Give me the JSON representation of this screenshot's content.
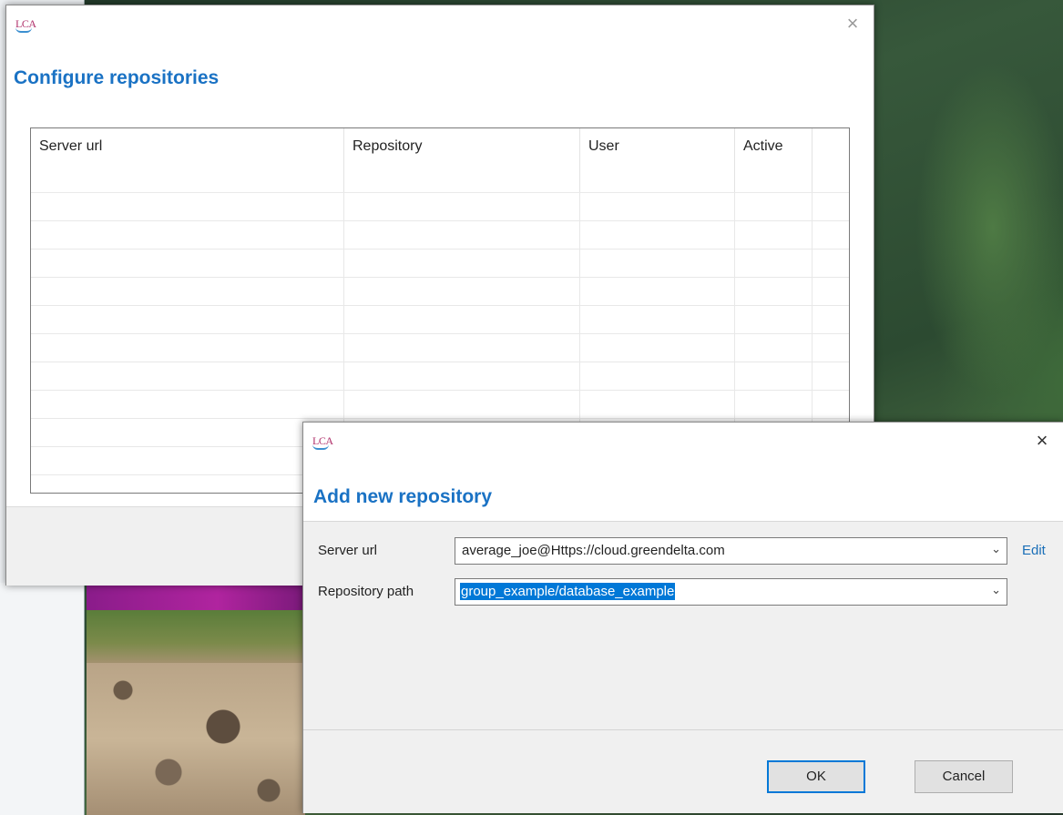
{
  "configure_dialog": {
    "app_icon_text": "LCA",
    "close_glyph": "×",
    "title": "Configure repositories",
    "table": {
      "columns": [
        "Server url",
        "Repository",
        "User",
        "Active"
      ],
      "rows": []
    }
  },
  "add_dialog": {
    "app_icon_text": "LCA",
    "close_glyph": "×",
    "title": "Add new repository",
    "server_url": {
      "label": "Server url",
      "value": "average_joe@Https://cloud.greendelta.com",
      "edit_label": "Edit"
    },
    "repository_path": {
      "label": "Repository path",
      "value": "group_example/database_example"
    },
    "ok_label": "OK",
    "cancel_label": "Cancel"
  },
  "icons": {
    "dropdown": "chevron-down-icon",
    "close": "close-icon",
    "app": "lca-app-icon"
  },
  "colors": {
    "accent_title": "#1a72c4",
    "selection": "#0078d7",
    "link": "#1a6fb8"
  }
}
